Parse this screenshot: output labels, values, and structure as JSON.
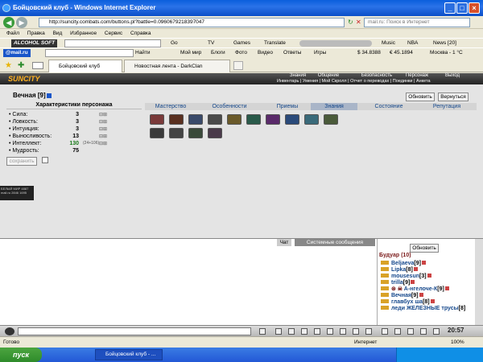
{
  "window": {
    "title": "Бойцовский клуб - Windows Internet Explorer"
  },
  "address": {
    "url": "http://suncity.combats.com/buttons.pl?battle=0.0960679218397047",
    "search_placeholder": "mail.ru: Поиск в Интернет"
  },
  "menu": [
    "Файл",
    "Правка",
    "Вид",
    "Избранное",
    "Сервис",
    "Справка"
  ],
  "toolbar1": {
    "brand": "ALCOHOL SOFT",
    "go": "Go",
    "tv": "TV",
    "games": "Games",
    "translate": "Translate",
    "music": "Music",
    "nba": "NBA",
    "news": "News [20]"
  },
  "toolbar2": {
    "mail": "@mail.ru",
    "find": "Найти",
    "my_world": "Мой мир",
    "blogs": "Блоги",
    "photo": "Фото",
    "video": "Видео",
    "answers": "Ответы",
    "games": "Игры",
    "usd": "$ 34.8388",
    "eur": "€ 45.1894",
    "weather": "Москва - 1 °C"
  },
  "tabs": [
    {
      "label": "Бойцовский клуб"
    },
    {
      "label": "Новостная лента - DarkClan"
    }
  ],
  "game": {
    "logo": "SUNCITY",
    "top_menu": [
      "Знания",
      "Общение",
      "Безопасность",
      "Персонаж",
      "Выход"
    ],
    "sub_menu": "Инвентарь | Умения | Мой Скролл | Отчет о переводах | Поединки | Анкета",
    "char_name": "Вечная [9]",
    "refresh": "Обновить",
    "back": "Вернуться",
    "stats_title": "Характеристики персонажа",
    "stats": [
      {
        "name": "• Сила:",
        "value": "3",
        "extra": ""
      },
      {
        "name": "• Ловкость:",
        "value": "3",
        "extra": ""
      },
      {
        "name": "• Интуиция:",
        "value": "3",
        "extra": ""
      },
      {
        "name": "• Выносливость:",
        "value": "13",
        "extra": ""
      },
      {
        "name": "• Интеллект:",
        "value": "130",
        "extra": "(24+106)"
      },
      {
        "name": "• Мудрость:",
        "value": "75",
        "extra": ""
      }
    ],
    "save": "сохранить",
    "nav": [
      "Мастерство",
      "Особенности",
      "Приемы",
      "Знания",
      "Состояние",
      "Репутация"
    ],
    "counter": [
      "БЕЛЫЙ МИР 4887",
      "mail.ru 2846 1695"
    ]
  },
  "chat": {
    "tab_chat": "Чат",
    "tab_system": "Системные сообщения",
    "refresh": "Обновить",
    "room": "Будуар (10)",
    "users": [
      {
        "name": "Beljaeva",
        "level": "[9]"
      },
      {
        "name": "Lipka",
        "level": "[8]"
      },
      {
        "name": "mousesun",
        "level": "[3]"
      },
      {
        "name": "trilla",
        "level": "[9]"
      },
      {
        "name": "A-нгелоче-К",
        "level": "[9]"
      },
      {
        "name": "Вечная",
        "level": "[9]"
      },
      {
        "name": "главбух ша",
        "level": "[8]"
      },
      {
        "name": "леди ЖЕЛЕЗНЫЕ трусы",
        "level": "[8]"
      }
    ],
    "clock": "20:57"
  },
  "status": {
    "left": "Готово",
    "zone": "Интернет",
    "zoom": "100%"
  },
  "taskbar": {
    "start": "пуск",
    "task": "Бойцовский клуб - ..."
  },
  "colors": {
    "accent": "#14478b",
    "title_bar": "#0a5fdc",
    "taskbar": "#2358d6"
  }
}
